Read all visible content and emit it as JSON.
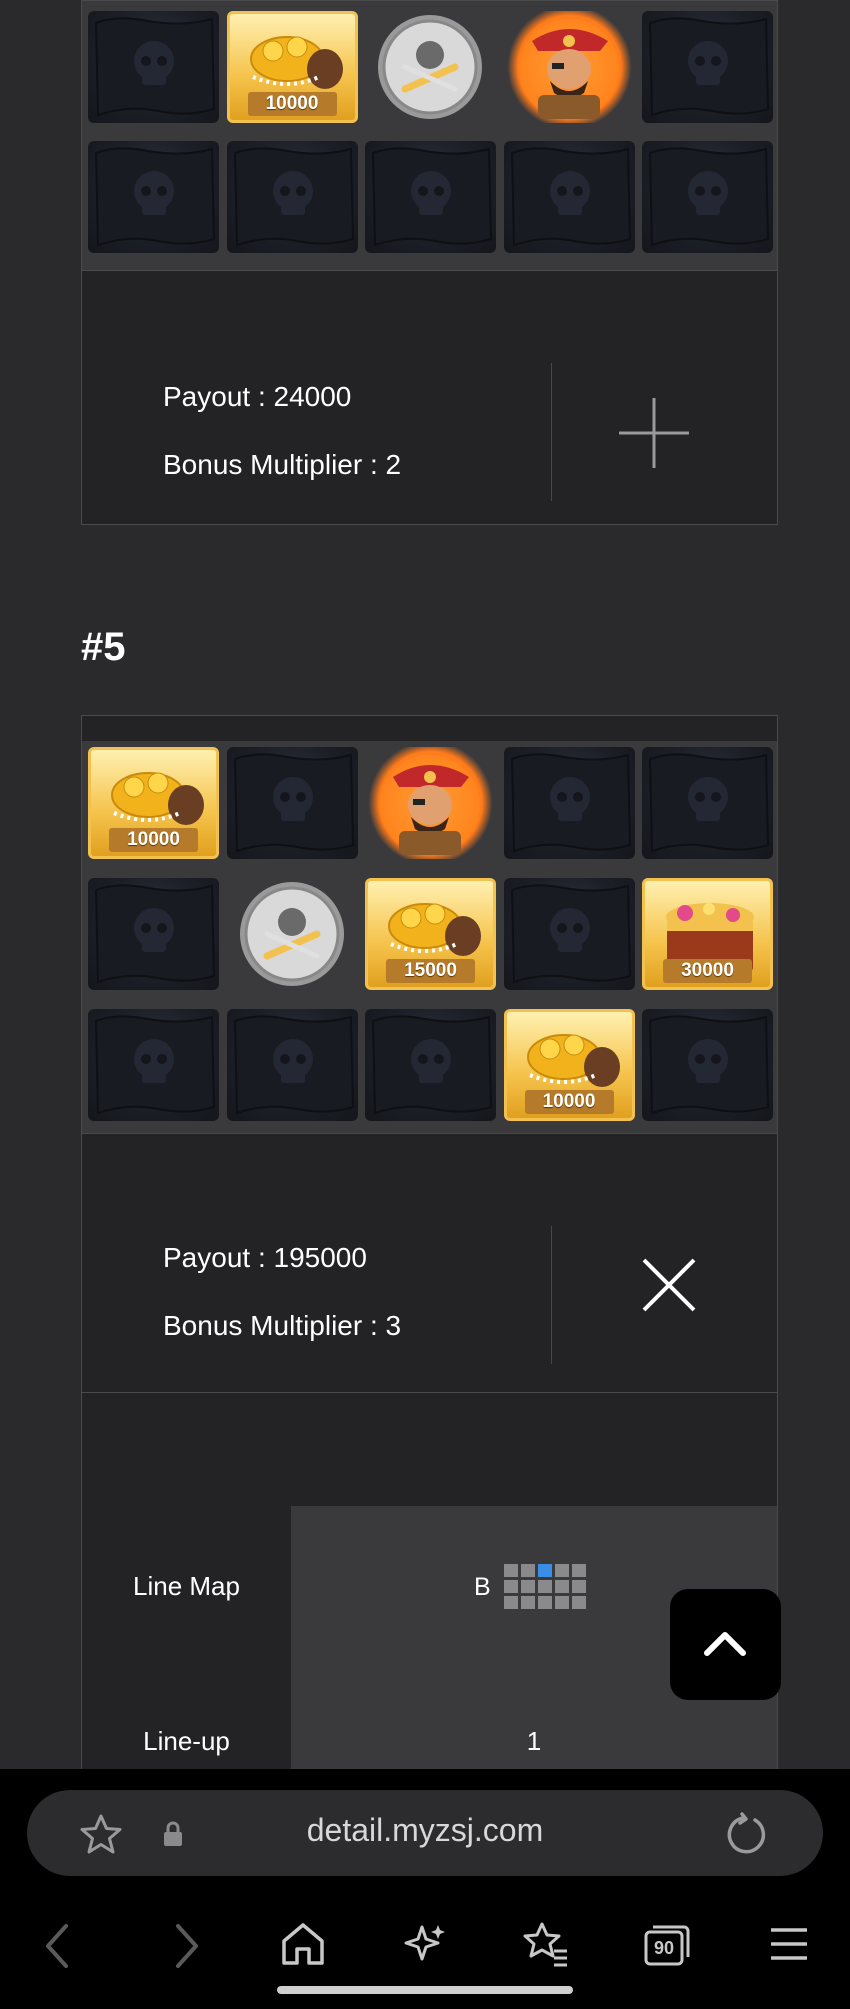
{
  "result4": {
    "payout_text": "Payout : 24000",
    "multiplier_text": "Bonus Multiplier : 2",
    "rows": [
      [
        "flag",
        "gold",
        "coin",
        "pirate",
        "flag"
      ],
      [
        "flag",
        "flag",
        "flag",
        "flag",
        "flag"
      ]
    ],
    "gold_labels": {
      "0_1": "10000"
    },
    "action_icon": "plus-icon"
  },
  "result5": {
    "title": "#5",
    "payout_text": "Payout : 195000",
    "multiplier_text": "Bonus Multiplier : 3",
    "rows": [
      [
        "gold",
        "flag",
        "pirate",
        "flag",
        "flag"
      ],
      [
        "flag",
        "coin",
        "gold",
        "flag",
        "chest"
      ],
      [
        "flag",
        "flag",
        "flag",
        "gold",
        "flag"
      ]
    ],
    "gold_labels": {
      "0_0": "10000",
      "1_2": "15000",
      "1_4": "30000",
      "2_3": "10000"
    },
    "action_icon": "close-icon",
    "line_map_label": "Line Map",
    "line_map_value": "B",
    "lineup_label": "Line-up",
    "lineup_value": "1"
  },
  "browser": {
    "url": "detail.myzsj.com",
    "tab_count": "90"
  }
}
